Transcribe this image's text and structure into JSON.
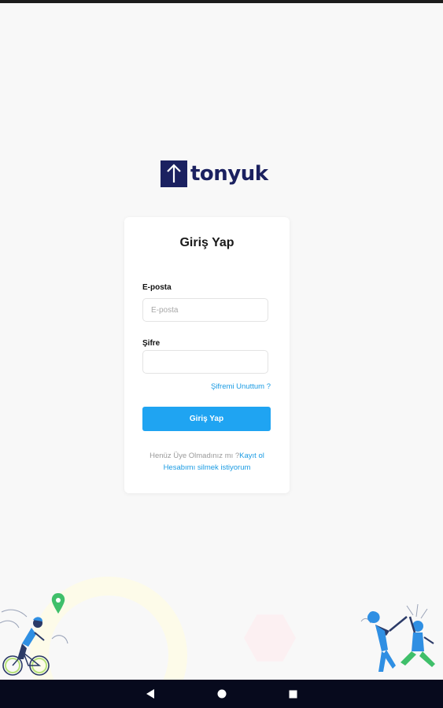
{
  "app": {
    "brand_name": "tonyuk",
    "brand_color": "#1b2160"
  },
  "login": {
    "title": "Giriş Yap",
    "email_label": "E-posta",
    "email_placeholder": "E-posta",
    "email_value": "",
    "password_label": "Şifre",
    "password_value": "",
    "forgot_password": "Şifremi Unuttum ?",
    "submit_label": "Giriş Yap",
    "no_account_text": "Henüz Üye Olmadınız mı ?",
    "signup_link": "Kayıt ol",
    "delete_account_link": "Hesabımı silmek istiyorum"
  },
  "colors": {
    "accent": "#1fa4f2",
    "link": "#1a9be3",
    "background": "#f8f8f8",
    "nav_bar": "#070a1d"
  },
  "icons": {
    "logo": "up-arrow-icon",
    "nav_back": "back-triangle-icon",
    "nav_home": "home-circle-icon",
    "nav_recents": "recents-square-icon"
  }
}
